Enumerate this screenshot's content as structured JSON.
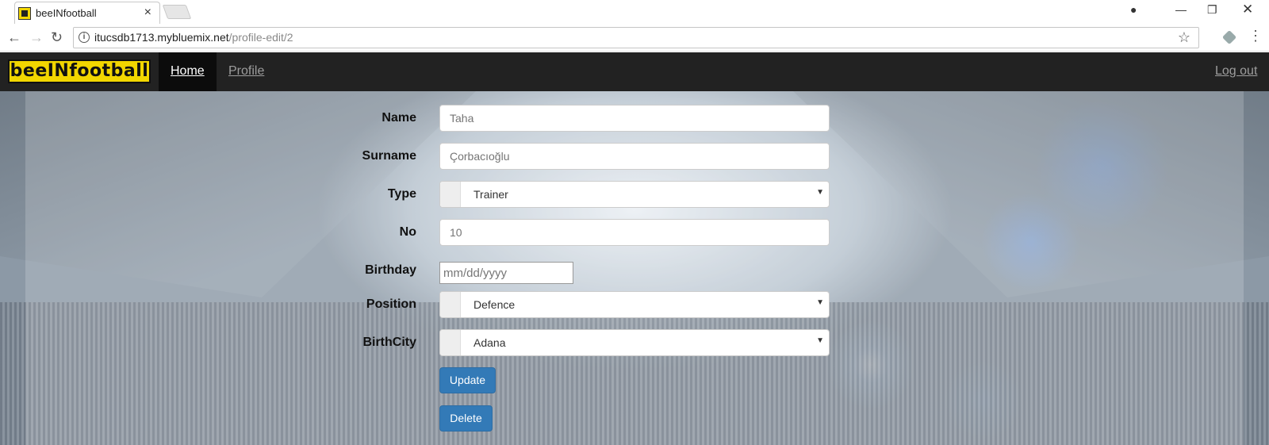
{
  "browser": {
    "tab_title": "beeINfootball",
    "url_host": "itucsdb1713.mybluemix.net",
    "url_path": "/profile-edit/2"
  },
  "navbar": {
    "brand": "beeINfootball",
    "home": "Home",
    "profile": "Profile",
    "logout": "Log out"
  },
  "form": {
    "name_label": "Name",
    "name_placeholder": "Taha",
    "surname_label": "Surname",
    "surname_placeholder": "Çorbacıoğlu",
    "type_label": "Type",
    "type_value": "Trainer",
    "no_label": "No",
    "no_placeholder": "10",
    "birthday_label": "Birthday",
    "birthday_placeholder": "mm/dd/yyyy",
    "position_label": "Position",
    "position_value": "Defence",
    "birthcity_label": "BirthCity",
    "birthcity_value": "Adana",
    "update_label": "Update",
    "delete_label": "Delete"
  },
  "colors": {
    "navbar_bg": "#222222",
    "brand_yellow": "#f2d600",
    "button_primary": "#337ab7"
  }
}
